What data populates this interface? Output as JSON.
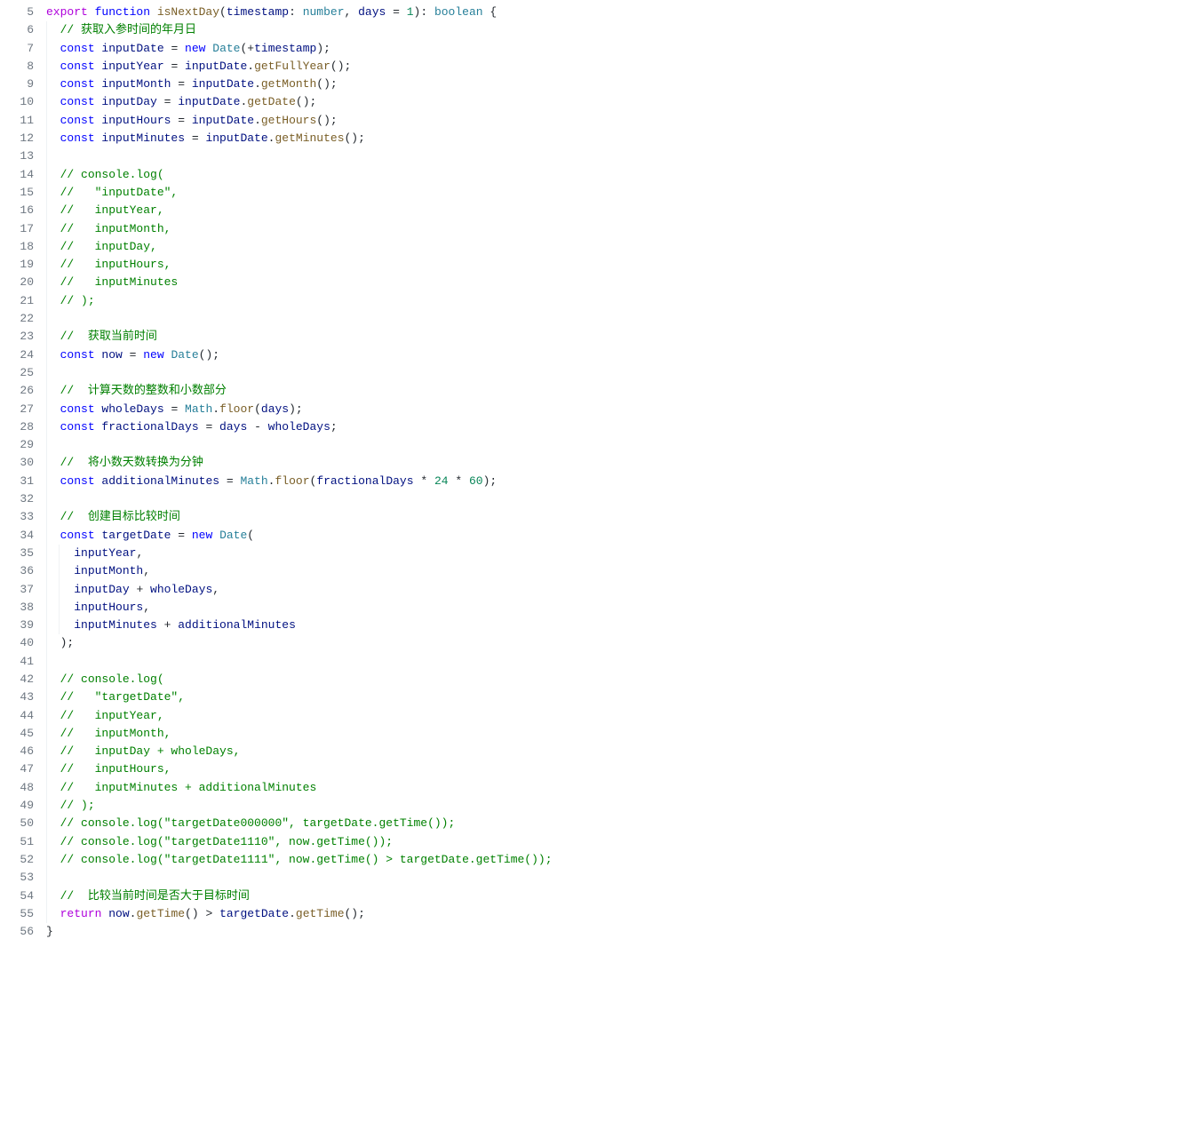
{
  "startLine": 5,
  "lines": [
    {
      "indent": 0,
      "tokens": [
        {
          "t": "export ",
          "c": "kw"
        },
        {
          "t": "function ",
          "c": "kw2"
        },
        {
          "t": "isNextDay",
          "c": "fn"
        },
        {
          "t": "(",
          "c": "punct"
        },
        {
          "t": "timestamp",
          "c": "param"
        },
        {
          "t": ": ",
          "c": "punct"
        },
        {
          "t": "number",
          "c": "type"
        },
        {
          "t": ", ",
          "c": "punct"
        },
        {
          "t": "days",
          "c": "param"
        },
        {
          "t": " = ",
          "c": "op"
        },
        {
          "t": "1",
          "c": "num"
        },
        {
          "t": "): ",
          "c": "punct"
        },
        {
          "t": "boolean",
          "c": "type"
        },
        {
          "t": " {",
          "c": "punct"
        }
      ]
    },
    {
      "indent": 1,
      "tokens": [
        {
          "t": "// 获取入参时间的年月日",
          "c": "cmt"
        }
      ]
    },
    {
      "indent": 1,
      "tokens": [
        {
          "t": "const ",
          "c": "kw2"
        },
        {
          "t": "inputDate",
          "c": "param"
        },
        {
          "t": " = ",
          "c": "op"
        },
        {
          "t": "new ",
          "c": "kw2"
        },
        {
          "t": "Date",
          "c": "type"
        },
        {
          "t": "(+",
          "c": "punct"
        },
        {
          "t": "timestamp",
          "c": "param"
        },
        {
          "t": ");",
          "c": "punct"
        }
      ]
    },
    {
      "indent": 1,
      "tokens": [
        {
          "t": "const ",
          "c": "kw2"
        },
        {
          "t": "inputYear",
          "c": "param"
        },
        {
          "t": " = ",
          "c": "op"
        },
        {
          "t": "inputDate",
          "c": "param"
        },
        {
          "t": ".",
          "c": "punct"
        },
        {
          "t": "getFullYear",
          "c": "fn"
        },
        {
          "t": "();",
          "c": "punct"
        }
      ]
    },
    {
      "indent": 1,
      "tokens": [
        {
          "t": "const ",
          "c": "kw2"
        },
        {
          "t": "inputMonth",
          "c": "param"
        },
        {
          "t": " = ",
          "c": "op"
        },
        {
          "t": "inputDate",
          "c": "param"
        },
        {
          "t": ".",
          "c": "punct"
        },
        {
          "t": "getMonth",
          "c": "fn"
        },
        {
          "t": "();",
          "c": "punct"
        }
      ]
    },
    {
      "indent": 1,
      "tokens": [
        {
          "t": "const ",
          "c": "kw2"
        },
        {
          "t": "inputDay",
          "c": "param"
        },
        {
          "t": " = ",
          "c": "op"
        },
        {
          "t": "inputDate",
          "c": "param"
        },
        {
          "t": ".",
          "c": "punct"
        },
        {
          "t": "getDate",
          "c": "fn"
        },
        {
          "t": "();",
          "c": "punct"
        }
      ]
    },
    {
      "indent": 1,
      "tokens": [
        {
          "t": "const ",
          "c": "kw2"
        },
        {
          "t": "inputHours",
          "c": "param"
        },
        {
          "t": " = ",
          "c": "op"
        },
        {
          "t": "inputDate",
          "c": "param"
        },
        {
          "t": ".",
          "c": "punct"
        },
        {
          "t": "getHours",
          "c": "fn"
        },
        {
          "t": "();",
          "c": "punct"
        }
      ]
    },
    {
      "indent": 1,
      "tokens": [
        {
          "t": "const ",
          "c": "kw2"
        },
        {
          "t": "inputMinutes",
          "c": "param"
        },
        {
          "t": " = ",
          "c": "op"
        },
        {
          "t": "inputDate",
          "c": "param"
        },
        {
          "t": ".",
          "c": "punct"
        },
        {
          "t": "getMinutes",
          "c": "fn"
        },
        {
          "t": "();",
          "c": "punct"
        }
      ]
    },
    {
      "indent": 1,
      "tokens": []
    },
    {
      "indent": 1,
      "tokens": [
        {
          "t": "// console.log(",
          "c": "cmt"
        }
      ]
    },
    {
      "indent": 1,
      "tokens": [
        {
          "t": "//   \"inputDate\",",
          "c": "cmt"
        }
      ]
    },
    {
      "indent": 1,
      "tokens": [
        {
          "t": "//   inputYear,",
          "c": "cmt"
        }
      ]
    },
    {
      "indent": 1,
      "tokens": [
        {
          "t": "//   inputMonth,",
          "c": "cmt"
        }
      ]
    },
    {
      "indent": 1,
      "tokens": [
        {
          "t": "//   inputDay,",
          "c": "cmt"
        }
      ]
    },
    {
      "indent": 1,
      "tokens": [
        {
          "t": "//   inputHours,",
          "c": "cmt"
        }
      ]
    },
    {
      "indent": 1,
      "tokens": [
        {
          "t": "//   inputMinutes",
          "c": "cmt"
        }
      ]
    },
    {
      "indent": 1,
      "tokens": [
        {
          "t": "// );",
          "c": "cmt"
        }
      ]
    },
    {
      "indent": 1,
      "tokens": []
    },
    {
      "indent": 1,
      "tokens": [
        {
          "t": "//  获取当前时间",
          "c": "cmt"
        }
      ]
    },
    {
      "indent": 1,
      "tokens": [
        {
          "t": "const ",
          "c": "kw2"
        },
        {
          "t": "now",
          "c": "param"
        },
        {
          "t": " = ",
          "c": "op"
        },
        {
          "t": "new ",
          "c": "kw2"
        },
        {
          "t": "Date",
          "c": "type"
        },
        {
          "t": "();",
          "c": "punct"
        }
      ]
    },
    {
      "indent": 1,
      "tokens": []
    },
    {
      "indent": 1,
      "tokens": [
        {
          "t": "//  计算天数的整数和小数部分",
          "c": "cmt"
        }
      ]
    },
    {
      "indent": 1,
      "tokens": [
        {
          "t": "const ",
          "c": "kw2"
        },
        {
          "t": "wholeDays",
          "c": "param"
        },
        {
          "t": " = ",
          "c": "op"
        },
        {
          "t": "Math",
          "c": "type"
        },
        {
          "t": ".",
          "c": "punct"
        },
        {
          "t": "floor",
          "c": "fn"
        },
        {
          "t": "(",
          "c": "punct"
        },
        {
          "t": "days",
          "c": "param"
        },
        {
          "t": ");",
          "c": "punct"
        }
      ]
    },
    {
      "indent": 1,
      "tokens": [
        {
          "t": "const ",
          "c": "kw2"
        },
        {
          "t": "fractionalDays",
          "c": "param"
        },
        {
          "t": " = ",
          "c": "op"
        },
        {
          "t": "days",
          "c": "param"
        },
        {
          "t": " - ",
          "c": "op"
        },
        {
          "t": "wholeDays",
          "c": "param"
        },
        {
          "t": ";",
          "c": "punct"
        }
      ]
    },
    {
      "indent": 1,
      "tokens": []
    },
    {
      "indent": 1,
      "tokens": [
        {
          "t": "//  将小数天数转换为分钟",
          "c": "cmt"
        }
      ]
    },
    {
      "indent": 1,
      "tokens": [
        {
          "t": "const ",
          "c": "kw2"
        },
        {
          "t": "additionalMinutes",
          "c": "param"
        },
        {
          "t": " = ",
          "c": "op"
        },
        {
          "t": "Math",
          "c": "type"
        },
        {
          "t": ".",
          "c": "punct"
        },
        {
          "t": "floor",
          "c": "fn"
        },
        {
          "t": "(",
          "c": "punct"
        },
        {
          "t": "fractionalDays",
          "c": "param"
        },
        {
          "t": " * ",
          "c": "op"
        },
        {
          "t": "24",
          "c": "num"
        },
        {
          "t": " * ",
          "c": "op"
        },
        {
          "t": "60",
          "c": "num"
        },
        {
          "t": ");",
          "c": "punct"
        }
      ]
    },
    {
      "indent": 1,
      "tokens": []
    },
    {
      "indent": 1,
      "tokens": [
        {
          "t": "//  创建目标比较时间",
          "c": "cmt"
        }
      ]
    },
    {
      "indent": 1,
      "tokens": [
        {
          "t": "const ",
          "c": "kw2"
        },
        {
          "t": "targetDate",
          "c": "param"
        },
        {
          "t": " = ",
          "c": "op"
        },
        {
          "t": "new ",
          "c": "kw2"
        },
        {
          "t": "Date",
          "c": "type"
        },
        {
          "t": "(",
          "c": "punct"
        }
      ]
    },
    {
      "indent": 2,
      "tokens": [
        {
          "t": "inputYear",
          "c": "param"
        },
        {
          "t": ",",
          "c": "punct"
        }
      ]
    },
    {
      "indent": 2,
      "tokens": [
        {
          "t": "inputMonth",
          "c": "param"
        },
        {
          "t": ",",
          "c": "punct"
        }
      ]
    },
    {
      "indent": 2,
      "tokens": [
        {
          "t": "inputDay",
          "c": "param"
        },
        {
          "t": " + ",
          "c": "op"
        },
        {
          "t": "wholeDays",
          "c": "param"
        },
        {
          "t": ",",
          "c": "punct"
        }
      ]
    },
    {
      "indent": 2,
      "tokens": [
        {
          "t": "inputHours",
          "c": "param"
        },
        {
          "t": ",",
          "c": "punct"
        }
      ]
    },
    {
      "indent": 2,
      "tokens": [
        {
          "t": "inputMinutes",
          "c": "param"
        },
        {
          "t": " + ",
          "c": "op"
        },
        {
          "t": "additionalMinutes",
          "c": "param"
        }
      ]
    },
    {
      "indent": 1,
      "tokens": [
        {
          "t": ");",
          "c": "punct"
        }
      ]
    },
    {
      "indent": 1,
      "tokens": []
    },
    {
      "indent": 1,
      "tokens": [
        {
          "t": "// console.log(",
          "c": "cmt"
        }
      ]
    },
    {
      "indent": 1,
      "tokens": [
        {
          "t": "//   \"targetDate\",",
          "c": "cmt"
        }
      ]
    },
    {
      "indent": 1,
      "tokens": [
        {
          "t": "//   inputYear,",
          "c": "cmt"
        }
      ]
    },
    {
      "indent": 1,
      "tokens": [
        {
          "t": "//   inputMonth,",
          "c": "cmt"
        }
      ]
    },
    {
      "indent": 1,
      "tokens": [
        {
          "t": "//   inputDay + wholeDays,",
          "c": "cmt"
        }
      ]
    },
    {
      "indent": 1,
      "tokens": [
        {
          "t": "//   inputHours,",
          "c": "cmt"
        }
      ]
    },
    {
      "indent": 1,
      "tokens": [
        {
          "t": "//   inputMinutes + additionalMinutes",
          "c": "cmt"
        }
      ]
    },
    {
      "indent": 1,
      "tokens": [
        {
          "t": "// );",
          "c": "cmt"
        }
      ]
    },
    {
      "indent": 1,
      "tokens": [
        {
          "t": "// console.log(\"targetDate000000\", targetDate.getTime());",
          "c": "cmt"
        }
      ]
    },
    {
      "indent": 1,
      "tokens": [
        {
          "t": "// console.log(\"targetDate1110\", now.getTime());",
          "c": "cmt"
        }
      ]
    },
    {
      "indent": 1,
      "tokens": [
        {
          "t": "// console.log(\"targetDate1111\", now.getTime() > targetDate.getTime());",
          "c": "cmt"
        }
      ]
    },
    {
      "indent": 1,
      "tokens": []
    },
    {
      "indent": 1,
      "tokens": [
        {
          "t": "//  比较当前时间是否大于目标时间",
          "c": "cmt"
        }
      ]
    },
    {
      "indent": 1,
      "tokens": [
        {
          "t": "return ",
          "c": "kw"
        },
        {
          "t": "now",
          "c": "param"
        },
        {
          "t": ".",
          "c": "punct"
        },
        {
          "t": "getTime",
          "c": "fn"
        },
        {
          "t": "() > ",
          "c": "punct"
        },
        {
          "t": "targetDate",
          "c": "param"
        },
        {
          "t": ".",
          "c": "punct"
        },
        {
          "t": "getTime",
          "c": "fn"
        },
        {
          "t": "();",
          "c": "punct"
        }
      ]
    },
    {
      "indent": 0,
      "tokens": [
        {
          "t": "}",
          "c": "punct"
        }
      ]
    }
  ]
}
